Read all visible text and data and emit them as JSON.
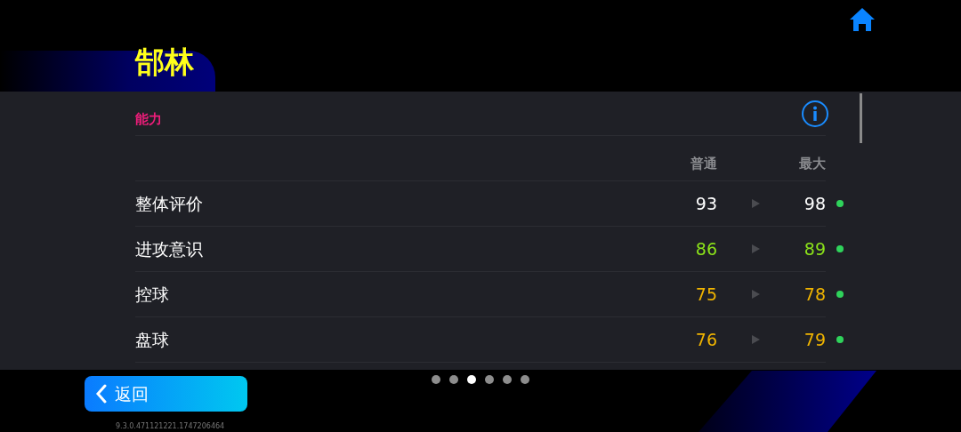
{
  "title": "郜林",
  "section": {
    "label": "能力"
  },
  "columns": [
    "普通",
    "最大"
  ],
  "rows": [
    {
      "name": "整体评价",
      "normal": "93",
      "max": "98",
      "color": "#ffffff"
    },
    {
      "name": "进攻意识",
      "normal": "86",
      "max": "89",
      "color": "#8be21a"
    },
    {
      "name": "控球",
      "normal": "75",
      "max": "78",
      "color": "#f0b400"
    },
    {
      "name": "盘球",
      "normal": "76",
      "max": "79",
      "color": "#f0b400"
    }
  ],
  "pages": [
    {
      "selected": false
    },
    {
      "selected": false
    },
    {
      "selected": true
    },
    {
      "selected": false
    },
    {
      "selected": false
    },
    {
      "selected": false
    }
  ],
  "back_button": "返回",
  "version": "9.3.0.471121221.1747206464"
}
